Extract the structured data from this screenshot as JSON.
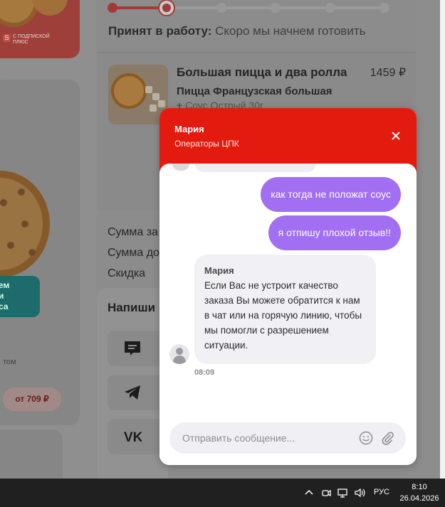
{
  "promo": {
    "subscription_text": "С ПОДПИСКОЙ ПЛЮС"
  },
  "left_products": {
    "tag_text": "ем\nи\nса",
    "partial_label": "том",
    "price_label": "от 709 ₽"
  },
  "order": {
    "progress": {
      "steps": 6,
      "current_step": 2
    },
    "status_label": "Принят в работу:",
    "status_value": "Скоро мы начнем готовить",
    "item": {
      "title": "Большая пицца и два ролла",
      "price": "1459 ₽",
      "subitem": "Пицца Французская большая",
      "extra": "Соус Острый 30г"
    },
    "summary_lines": [
      "Сумма за",
      "Сумма до",
      "Скидка"
    ]
  },
  "write_sheet": {
    "title": "Напиши"
  },
  "chat": {
    "operator_name": "Мария",
    "operator_group": "Операторы ЦПК",
    "messages_out": [
      "как тогда не положат соус",
      "я отпишу плохой отзыв!!"
    ],
    "message_in": {
      "author": "Мария",
      "text": "Если Вас не устроит качество заказа Вы можете обратится к нам в чат или на горячую линию, чтобы мы помогли с разрешением ситуации.",
      "time": "08:09"
    },
    "input_placeholder": "Отправить сообщение..."
  },
  "taskbar": {
    "language": "РУС",
    "time": "8:10",
    "date": "26.04.2026"
  },
  "colors": {
    "accent_red": "#e31b0e",
    "bubble_purple": "#a26ff3",
    "incoming_bubble": "#f1f0f5"
  }
}
